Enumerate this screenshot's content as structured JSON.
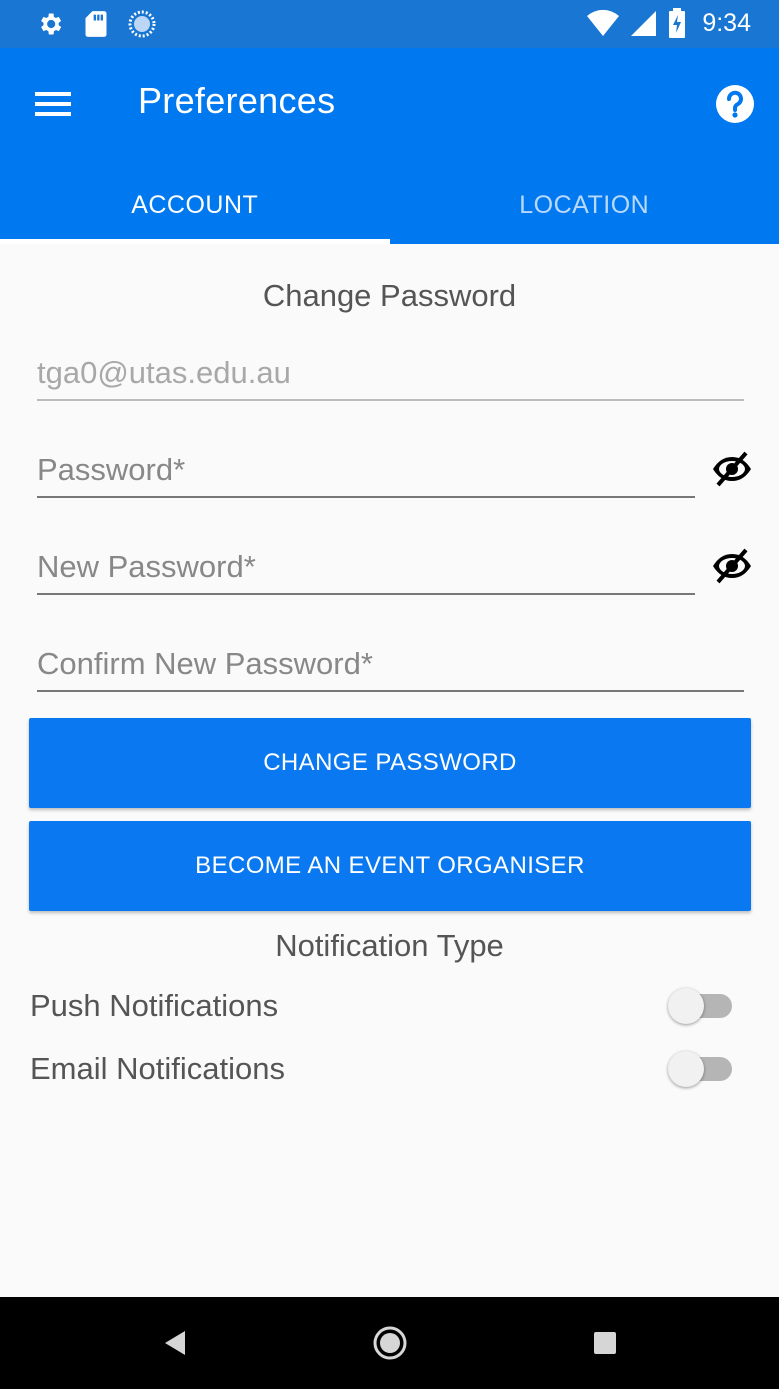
{
  "status_bar": {
    "time": "9:34",
    "icons": [
      "settings-icon",
      "sd-card-icon",
      "sync-icon",
      "wifi-icon",
      "signal-icon",
      "battery-charging-icon"
    ]
  },
  "app_bar": {
    "title": "Preferences",
    "menu_icon": "hamburger-menu-icon",
    "help_icon": "help-circle-icon",
    "tabs": [
      {
        "label": "ACCOUNT",
        "active": true
      },
      {
        "label": "LOCATION",
        "active": false
      }
    ]
  },
  "change_password": {
    "heading": "Change Password",
    "email_value": "tga0@utas.edu.au",
    "password_placeholder": "Password*",
    "new_password_placeholder": "New Password*",
    "confirm_password_placeholder": "Confirm New Password*",
    "change_button": "CHANGE PASSWORD",
    "organiser_button": "BECOME AN EVENT ORGANISER"
  },
  "notifications": {
    "heading": "Notification Type",
    "items": [
      {
        "label": "Push Notifications",
        "enabled": false
      },
      {
        "label": "Email Notifications",
        "enabled": false
      }
    ]
  },
  "colors": {
    "status_bar": "#1976d2",
    "primary": "#0078f0",
    "background": "#fafafa"
  },
  "nav_bar": {
    "icons": [
      "back-icon",
      "home-icon",
      "recents-icon"
    ]
  }
}
